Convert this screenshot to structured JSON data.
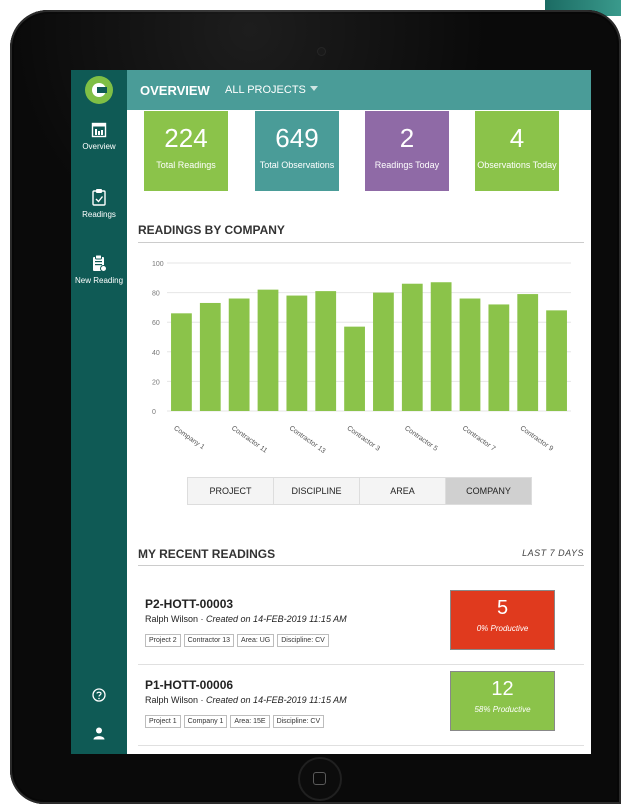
{
  "header": {
    "title": "OVERVIEW",
    "project_filter": "ALL PROJECTS"
  },
  "sidebar": {
    "items": [
      {
        "label": "Overview"
      },
      {
        "label": "Readings"
      },
      {
        "label": "New Reading"
      }
    ]
  },
  "stats": [
    {
      "value": "224",
      "label": "Total Readings",
      "color": "#8bc34a"
    },
    {
      "value": "649",
      "label": "Total Observations",
      "color": "#4a9c98"
    },
    {
      "value": "2",
      "label": "Readings Today",
      "color": "#8f6aa6"
    },
    {
      "value": "4",
      "label": "Observations Today",
      "color": "#8bc34a"
    }
  ],
  "chart_section": {
    "title": "READINGS BY COMPANY"
  },
  "chart_data": {
    "type": "bar",
    "categories": [
      "Company 1",
      "",
      "Contractor 11",
      "",
      "Contractor 13",
      "",
      "Contractor 3",
      "",
      "Contractor 5",
      "",
      "Contractor 7",
      "",
      "Contractor 9",
      ""
    ],
    "values": [
      66,
      73,
      76,
      82,
      78,
      81,
      57,
      80,
      86,
      87,
      76,
      72,
      79,
      68
    ],
    "ylim": [
      0,
      100
    ],
    "yticks": [
      "0",
      "20",
      "40",
      "60",
      "80",
      "100"
    ],
    "bar_color": "#8bc34a",
    "grid": true
  },
  "group_by": {
    "options": [
      "PROJECT",
      "DISCIPLINE",
      "AREA",
      "COMPANY"
    ],
    "selected": "COMPANY"
  },
  "recent": {
    "title": "MY RECENT READINGS",
    "range": "LAST 7 DAYS",
    "items": [
      {
        "id": "P2-HOTT-00003",
        "user": "Ralph Wilson",
        "created": "Created on 14-FEB-2019 11:15 AM",
        "tags": [
          "Project 2",
          "Contractor 13",
          "Area: UG",
          "Discipline: CV"
        ],
        "score": "5",
        "productive": "0% Productive",
        "color": "#e03a1e"
      },
      {
        "id": "P1-HOTT-00006",
        "user": "Ralph Wilson",
        "created": "Created on 14-FEB-2019 11:15 AM",
        "tags": [
          "Project 1",
          "Company 1",
          "Area: 15E",
          "Discipline: CV"
        ],
        "score": "12",
        "productive": "58% Productive",
        "color": "#8bc34a"
      }
    ]
  }
}
